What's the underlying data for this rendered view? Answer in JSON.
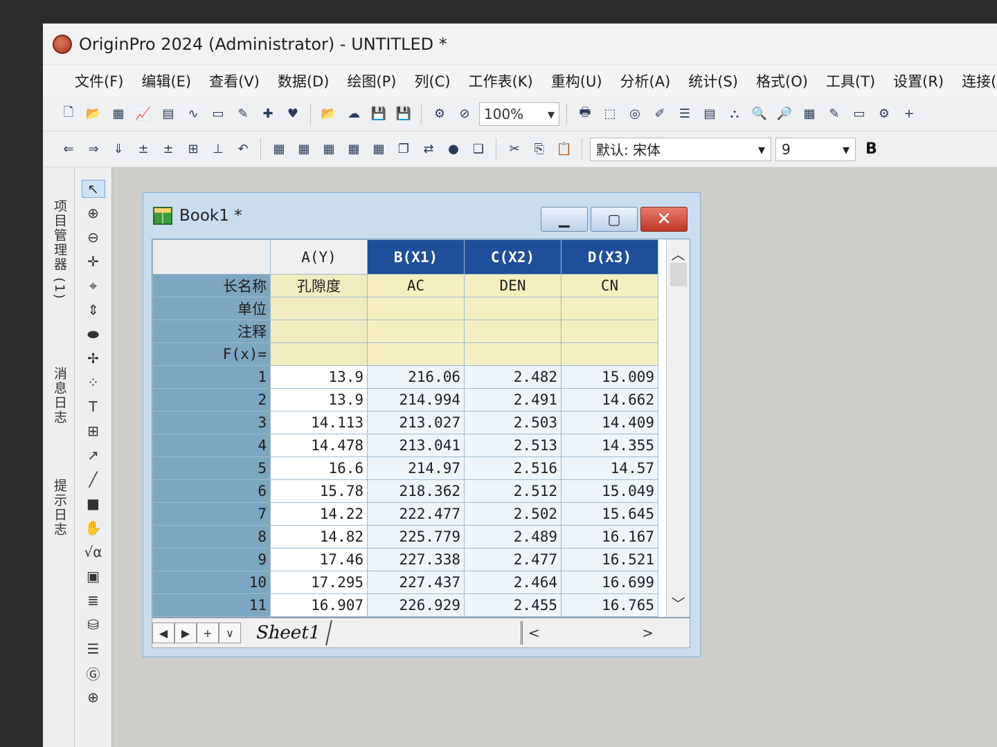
{
  "window": {
    "title": "OriginPro 2024 (Administrator) - UNTITLED *"
  },
  "menu": [
    "文件(F)",
    "编辑(E)",
    "查看(V)",
    "数据(D)",
    "绘图(P)",
    "列(C)",
    "工作表(K)",
    "重构(U)",
    "分析(A)",
    "统计(S)",
    "格式(O)",
    "工具(T)",
    "设置(R)",
    "连接(N)"
  ],
  "toolbar": {
    "zoom": "100%",
    "font_name": "默认: 宋体",
    "font_size": "9",
    "bold": "B"
  },
  "dock": {
    "project_explorer": "项目管理器 (1)",
    "messages_log": "消息日志",
    "hint_log": "提示日志"
  },
  "book": {
    "title": "Book1 *",
    "sheet_tab": "Sheet1",
    "columns": [
      "A(Y)",
      "B(X1)",
      "C(X2)",
      "D(X3)"
    ],
    "selected_column": 1,
    "meta_labels": [
      "长名称",
      "单位",
      "注释",
      "F(x)="
    ],
    "long_names": [
      "孔隙度",
      "AC",
      "DEN",
      "CN"
    ],
    "rows": [
      {
        "n": "1",
        "v": [
          "13.9",
          "216.06",
          "2.482",
          "15.009"
        ]
      },
      {
        "n": "2",
        "v": [
          "13.9",
          "214.994",
          "2.491",
          "14.662"
        ]
      },
      {
        "n": "3",
        "v": [
          "14.113",
          "213.027",
          "2.503",
          "14.409"
        ]
      },
      {
        "n": "4",
        "v": [
          "14.478",
          "213.041",
          "2.513",
          "14.355"
        ]
      },
      {
        "n": "5",
        "v": [
          "16.6",
          "214.97",
          "2.516",
          "14.57"
        ]
      },
      {
        "n": "6",
        "v": [
          "15.78",
          "218.362",
          "2.512",
          "15.049"
        ]
      },
      {
        "n": "7",
        "v": [
          "14.22",
          "222.477",
          "2.502",
          "15.645"
        ]
      },
      {
        "n": "8",
        "v": [
          "14.82",
          "225.779",
          "2.489",
          "16.167"
        ]
      },
      {
        "n": "9",
        "v": [
          "17.46",
          "227.338",
          "2.477",
          "16.521"
        ]
      },
      {
        "n": "10",
        "v": [
          "17.295",
          "227.437",
          "2.464",
          "16.699"
        ]
      },
      {
        "n": "11",
        "v": [
          "16.907",
          "226.929",
          "2.455",
          "16.765"
        ]
      }
    ]
  }
}
